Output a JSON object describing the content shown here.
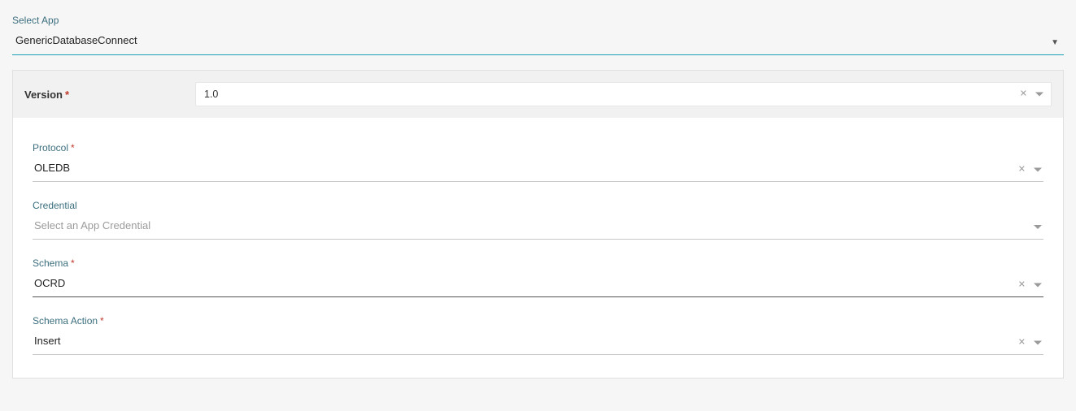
{
  "selectApp": {
    "label": "Select App",
    "value": "GenericDatabaseConnect"
  },
  "version": {
    "label": "Version",
    "value": "1.0"
  },
  "fields": {
    "protocol": {
      "label": "Protocol",
      "value": "OLEDB",
      "required": true,
      "clearable": true
    },
    "credential": {
      "label": "Credential",
      "placeholder": "Select an App Credential",
      "value": "",
      "required": false,
      "clearable": false
    },
    "schema": {
      "label": "Schema",
      "value": "OCRD",
      "required": true,
      "clearable": true
    },
    "schemaAction": {
      "label": "Schema Action",
      "value": "Insert",
      "required": true,
      "clearable": true
    }
  }
}
